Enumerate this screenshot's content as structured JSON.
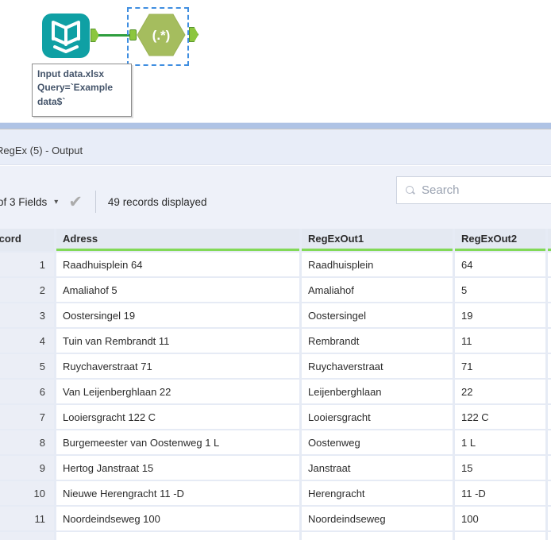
{
  "workflow": {
    "input_tool": {
      "tool": "Input Data",
      "annotation": {
        "line1": "Input data.xlsx",
        "line2": "Query=`Example",
        "line3": "data$`"
      }
    },
    "regex_tool": {
      "icon_text": "(.*)"
    }
  },
  "results_pane": {
    "title": "RegEx (5) - Output",
    "toolbar": {
      "fields_summary": "of 3 Fields",
      "caret_icon": "▾",
      "check_icon": "✔",
      "records_summary": "49 records displayed",
      "search_placeholder": "Search",
      "search_icon": "magnifier"
    },
    "table": {
      "columns": [
        "Record",
        "Adress",
        "RegExOut1",
        "RegExOut2"
      ],
      "rows": [
        [
          "1",
          "Raadhuisplein 64",
          "Raadhuisplein",
          "64"
        ],
        [
          "2",
          "Amaliahof 5",
          "Amaliahof",
          "5"
        ],
        [
          "3",
          "Oostersingel 19",
          "Oostersingel",
          "19"
        ],
        [
          "4",
          "Tuin van Rembrandt 11",
          "Rembrandt",
          "11"
        ],
        [
          "5",
          "Ruychaverstraat 71",
          "Ruychaverstraat",
          "71"
        ],
        [
          "6",
          "Van Leijenberghlaan 22",
          "Leijenberghlaan",
          "22"
        ],
        [
          "7",
          "Looiersgracht 122 C",
          "Looiersgracht",
          "122 C"
        ],
        [
          "8",
          "Burgemeester van Oostenweg 1 L",
          "Oostenweg",
          "1 L"
        ],
        [
          "9",
          "Hertog Janstraat 15",
          "Janstraat",
          "15"
        ],
        [
          "10",
          "Nieuwe Herengracht 11 -D",
          "Herengracht",
          "11 -D"
        ],
        [
          "11",
          "Noordeindseweg 100",
          "Noordeindseweg",
          "100"
        ]
      ]
    }
  },
  "colors": {
    "tool_teal": "#0FA0A4",
    "tool_green": "#A5BD5E",
    "anchor_green": "#8CC63E",
    "connection_green": "#2E9E3E",
    "selection_blue": "#3F8EE0",
    "header_underline_green": "#82D957",
    "splitter_blue": "#AFC3E5"
  }
}
